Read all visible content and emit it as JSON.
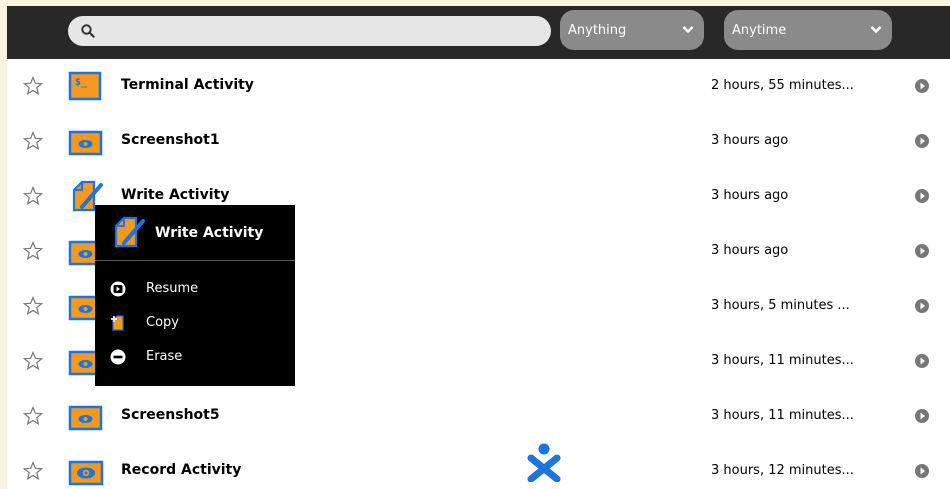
{
  "toolbar": {
    "search": {
      "value": "",
      "placeholder": ""
    },
    "what_filter": {
      "selected": "Anything"
    },
    "when_filter": {
      "selected": "Anytime"
    }
  },
  "entries": [
    {
      "title": "Terminal Activity",
      "time": "2 hours, 55 minutes...",
      "icon": "terminal-icon",
      "starred": false
    },
    {
      "title": "Screenshot1",
      "time": "3 hours ago",
      "icon": "image-viewer-icon",
      "starred": false
    },
    {
      "title": "Write Activity",
      "time": "3 hours ago",
      "icon": "write-icon",
      "starred": false
    },
    {
      "title": "",
      "time": "3 hours ago",
      "icon": "image-viewer-icon",
      "starred": false
    },
    {
      "title": "",
      "time": "3 hours, 5 minutes ...",
      "icon": "image-viewer-icon",
      "starred": false
    },
    {
      "title": "",
      "time": "3 hours, 11 minutes...",
      "icon": "image-viewer-icon",
      "starred": false
    },
    {
      "title": "Screenshot5",
      "time": "3 hours, 11 minutes...",
      "icon": "image-viewer-icon",
      "starred": false
    },
    {
      "title": "Record Activity",
      "time": "3 hours, 12 minutes...",
      "icon": "record-icon",
      "starred": false
    }
  ],
  "palette": {
    "title": "Write Activity",
    "items": [
      {
        "label": "Resume",
        "icon": "resume-icon"
      },
      {
        "label": "Copy",
        "icon": "copy-icon"
      },
      {
        "label": "Erase",
        "icon": "erase-icon"
      }
    ]
  },
  "colors": {
    "accent_orange": "#f39a1e",
    "icon_blue": "#1d73e0",
    "toolbar_bg": "#282828",
    "dropdown_bg": "#8a8a8a",
    "page_bg": "#fdf3e1"
  }
}
